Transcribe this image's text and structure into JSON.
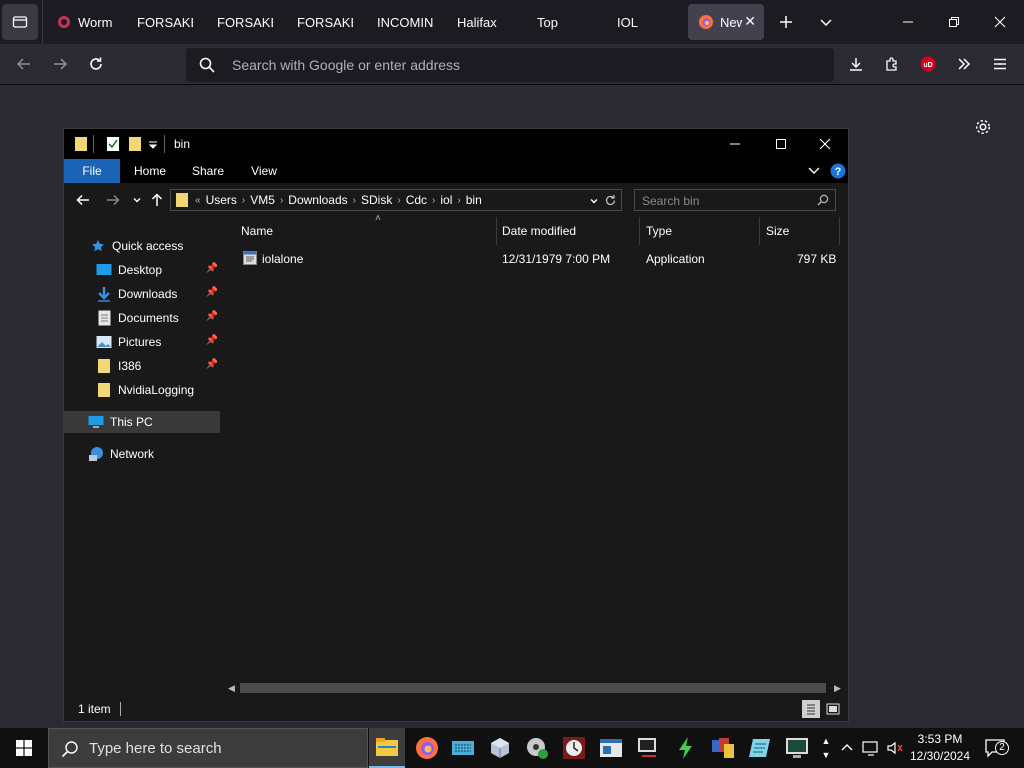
{
  "browser": {
    "tabs": [
      {
        "label": "Worm",
        "icon": "site-icon-red"
      },
      {
        "label": "FORSAKEN"
      },
      {
        "label": "FORSAKEN"
      },
      {
        "label": "FORSAKEN"
      },
      {
        "label": "INCOMING"
      },
      {
        "label": "Halifax"
      },
      {
        "label": "Top"
      },
      {
        "label": "IOL"
      }
    ],
    "active_tab": {
      "label": "New",
      "icon": "firefox-icon"
    },
    "url_placeholder": "Search with Google or enter address"
  },
  "explorer": {
    "title": "bin",
    "ribbon_tabs": [
      "File",
      "Home",
      "Share",
      "View"
    ],
    "breadcrumb": [
      "Users",
      "VM5",
      "Downloads",
      "SDisk",
      "Cdc",
      "iol",
      "bin"
    ],
    "search_placeholder": "Search bin",
    "nav": {
      "quick_access": "Quick access",
      "items": [
        "Desktop",
        "Downloads",
        "Documents",
        "Pictures",
        "I386",
        "NvidiaLogging"
      ],
      "this_pc": "This PC",
      "network": "Network"
    },
    "columns": [
      "Name",
      "Date modified",
      "Type",
      "Size"
    ],
    "files": [
      {
        "name": "iolalone",
        "date": "12/31/1979 7:00 PM",
        "type": "Application",
        "size": "797 KB"
      }
    ],
    "status": "1 item"
  },
  "taskbar": {
    "search_placeholder": "Type here to search",
    "time": "3:53 PM",
    "date": "12/30/2024",
    "notification_count": "2"
  },
  "colors": {
    "browser_bg": "#2b2a33",
    "tabstrip_bg": "#1c1b22",
    "file_tab_accent": "#1a63b5",
    "folder_yellow": "#f3d774"
  }
}
